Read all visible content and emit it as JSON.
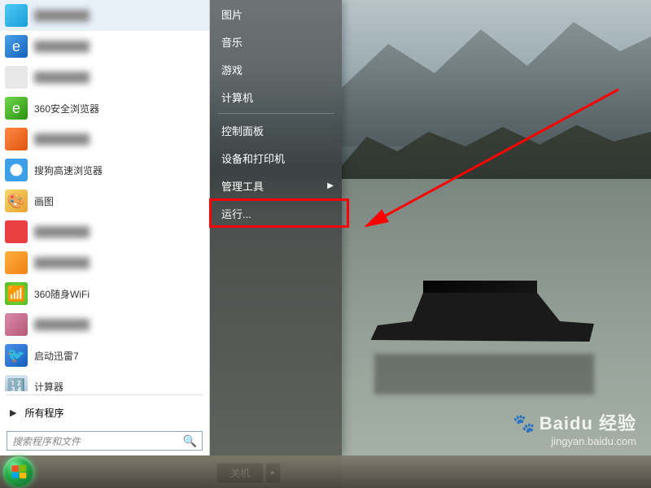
{
  "programs": [
    {
      "label": "",
      "blurred": true,
      "icon_bg": "linear-gradient(135deg,#4ec9f5,#1a9fd8)",
      "icon_glyph": ""
    },
    {
      "label": "",
      "blurred": true,
      "icon_bg": "linear-gradient(135deg,#4aa3e8,#1560bd)",
      "icon_glyph": "e"
    },
    {
      "label": "",
      "blurred": true,
      "icon_bg": "#e8e8e8",
      "icon_glyph": ""
    },
    {
      "label": "360安全浏览器",
      "blurred": false,
      "icon_bg": "linear-gradient(135deg,#6ed84a,#2a9010)",
      "icon_glyph": "e"
    },
    {
      "label": "",
      "blurred": true,
      "icon_bg": "linear-gradient(135deg,#ff8844,#e05510)",
      "icon_glyph": ""
    },
    {
      "label": "搜狗高速浏览器",
      "blurred": false,
      "icon_bg": "radial-gradient(circle,#fff 35%,#3ca0e8 40%)",
      "icon_glyph": "S"
    },
    {
      "label": "画图",
      "blurred": false,
      "icon_bg": "linear-gradient(135deg,#f5d86a,#e8a030)",
      "icon_glyph": "🎨"
    },
    {
      "label": "",
      "blurred": true,
      "icon_bg": "#e84040",
      "icon_glyph": ""
    },
    {
      "label": "",
      "blurred": true,
      "icon_bg": "linear-gradient(135deg,#ffb040,#f08010)",
      "icon_glyph": ""
    },
    {
      "label": "360随身WiFi",
      "blurred": false,
      "icon_bg": "radial-gradient(circle,#9ae858,#4ab818)",
      "icon_glyph": "📶"
    },
    {
      "label": "",
      "blurred": true,
      "icon_bg": "linear-gradient(135deg,#d88aa8,#b85878)",
      "icon_glyph": ""
    },
    {
      "label": "启动迅雷7",
      "blurred": false,
      "icon_bg": "linear-gradient(135deg,#4a90e8,#1560bd)",
      "icon_glyph": "🐦"
    },
    {
      "label": "计算器",
      "blurred": false,
      "icon_bg": "linear-gradient(180deg,#d8e4f0,#a8c0d8)",
      "icon_glyph": "🔢"
    }
  ],
  "all_programs_label": "所有程序",
  "search_placeholder": "搜索程序和文件",
  "right_menu": {
    "group1": [
      "图片",
      "音乐",
      "游戏",
      "计算机"
    ],
    "group2": [
      "控制面板",
      "设备和打印机",
      {
        "label": "管理工具",
        "submenu": true
      },
      {
        "label": "运行...",
        "highlighted": true
      }
    ]
  },
  "shutdown_label": "关机",
  "watermark": {
    "brand": "Baidu 经验",
    "url": "jingyan.baidu.com"
  }
}
